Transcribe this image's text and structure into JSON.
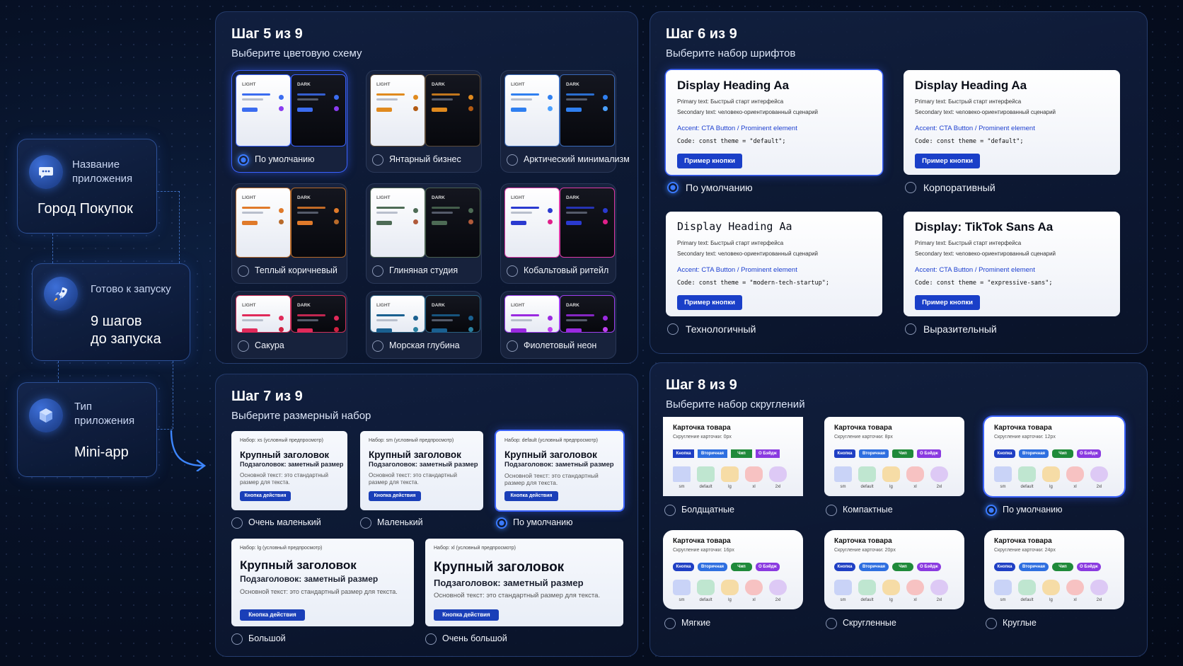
{
  "sidebar": {
    "app_name": {
      "label": "Название\nприложения",
      "value": "Город Покупок"
    },
    "launch": {
      "label": "Готово к запуску",
      "value": "9 шагов\nдо запуска"
    },
    "app_type": {
      "label": "Тип\nприложения",
      "value": "Mini-app"
    }
  },
  "step5": {
    "step": "Шаг 5 из 9",
    "subtitle": "Выберите цветовую схему",
    "light_tag": "LIGHT",
    "dark_tag": "DARK",
    "options": [
      {
        "label": "По умолчанию",
        "selected": true,
        "accent": "#3b6cf0",
        "dot2": "#8a3bf0",
        "border": "#3a62ff"
      },
      {
        "label": "Янтарный бизнес",
        "selected": false,
        "accent": "#e08a1e",
        "dot2": "#b25a12",
        "border": "#5a4a38"
      },
      {
        "label": "Арктический минимализм",
        "selected": false,
        "accent": "#2f7ff0",
        "dot2": "#4aa0ff",
        "border": "#3a6ab8"
      },
      {
        "label": "Теплый коричневый",
        "selected": false,
        "accent": "#e07a2a",
        "dot2": "#b86a2a",
        "border": "#b66a2a"
      },
      {
        "label": "Глиняная студия",
        "selected": false,
        "accent": "#4d6b55",
        "dot2": "#b05a3a",
        "border": "#4a6050"
      },
      {
        "label": "Кобальтовый ритейл",
        "selected": false,
        "accent": "#2a3ad0",
        "dot2": "#e0208a",
        "border": "#e03aa8"
      },
      {
        "label": "Сакура",
        "selected": false,
        "accent": "#e02a5a",
        "dot2": "#d02040",
        "border": "#d0305a"
      },
      {
        "label": "Морская глубина",
        "selected": false,
        "accent": "#1a6090",
        "dot2": "#2a80a0",
        "border": "#2a6080"
      },
      {
        "label": "Фиолетовый неон",
        "selected": false,
        "accent": "#9a2ae0",
        "dot2": "#c040f0",
        "border": "#a040f0"
      }
    ]
  },
  "step6": {
    "step": "Шаг 6 из 9",
    "subtitle": "Выберите набор шрифтов",
    "primary": "Primary text: Быстрый старт интерфейса",
    "secondary": "Secondary text: человеко-ориентированный сценарий",
    "accent": "Accent: CTA Button / Prominent element",
    "button": "Пример кнопки",
    "options": [
      {
        "label": "По умолчанию",
        "selected": true,
        "heading": "Display Heading Aa",
        "code": "Code: const theme = \"default\";",
        "mono": false
      },
      {
        "label": "Корпоративный",
        "selected": false,
        "heading": "Display Heading Aa",
        "code": "Code: const theme = \"default\";",
        "mono": false
      },
      {
        "label": "Технологичный",
        "selected": false,
        "heading": "Display Heading Aa",
        "code": "Code: const theme = \"modern-tech-startup\";",
        "mono": true
      },
      {
        "label": "Выразительный",
        "selected": false,
        "heading": "Display: TikTok Sans Aa",
        "code": "Code: const theme = \"expressive-sans\";",
        "mono": false
      }
    ]
  },
  "step7": {
    "step": "Шаг 7 из 9",
    "subtitle": "Выберите размерный набор",
    "heading": "Крупный заголовок",
    "subheading": "Подзаголовок: заметный размер",
    "body": "Основной текст: это стандартный размер для текста.",
    "cta": "Кнопка действия",
    "options": [
      {
        "label": "Очень маленький",
        "selected": false,
        "meta": "Набор: xs (условный предпросмотр)"
      },
      {
        "label": "Маленький",
        "selected": false,
        "meta": "Набор: sm (условный предпросмотр)"
      },
      {
        "label": "По умолчанию",
        "selected": true,
        "meta": "Набор: default (условный предпросмотр)"
      },
      {
        "label": "Большой",
        "selected": false,
        "meta": "Набор: lg (условный предпросмотр)"
      },
      {
        "label": "Очень большой",
        "selected": false,
        "meta": "Набор: xl (условный предпросмотр)"
      }
    ]
  },
  "step8": {
    "step": "Шаг 8 из 9",
    "subtitle": "Выберите набор скруглений",
    "card_title": "Карточка товара",
    "chips": [
      {
        "label": "Кнопка",
        "color": "#1f3fc4"
      },
      {
        "label": "Вторичная",
        "color": "#2f6fe0"
      },
      {
        "label": "Чип",
        "color": "#1f8a3a"
      },
      {
        "label": "О Бэйдж",
        "color": "#8a3ae0"
      }
    ],
    "swatch_labels": [
      "sm",
      "default",
      "lg",
      "xl",
      "2xl"
    ],
    "swatch_colors": [
      "#c9d3f7",
      "#bfe6d0",
      "#f6dca6",
      "#f7c2c2",
      "#ddc9f5"
    ],
    "options": [
      {
        "label": "Болдщатные",
        "selected": false,
        "radius_text": "Скругление карточки: 0px",
        "radius": 0
      },
      {
        "label": "Компактные",
        "selected": false,
        "radius_text": "Скругление карточки: 8px",
        "radius": 8
      },
      {
        "label": "По умолчанию",
        "selected": true,
        "radius_text": "Скругление карточки: 12px",
        "radius": 12
      },
      {
        "label": "Мягкие",
        "selected": false,
        "radius_text": "Скругление карточки: 16px",
        "radius": 16
      },
      {
        "label": "Скругленные",
        "selected": false,
        "radius_text": "Скругление карточки: 20px",
        "radius": 20
      },
      {
        "label": "Круглые",
        "selected": false,
        "radius_text": "Скругление карточки: 24px",
        "radius": 24
      }
    ]
  }
}
